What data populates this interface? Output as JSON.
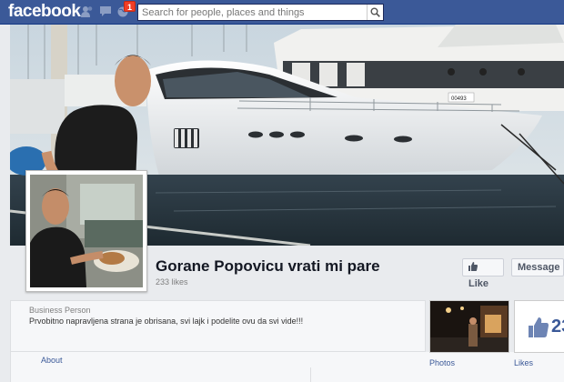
{
  "topbar": {
    "logo": "facebook",
    "notification_count": "1",
    "search_placeholder": "Search for people, places and things"
  },
  "page": {
    "title": "Gorane Popovicu vrati mi pare",
    "likes": "233 likes",
    "like_button": "Like",
    "message_button": "Message",
    "category": "Business Person",
    "description": "Prvobitno napravljena strana je obrisana, svi lajk i podelite ovu da svi vide!!!"
  },
  "tabs": {
    "about": "About",
    "photos": "Photos",
    "likes": "Likes",
    "likes_big_number": "23"
  },
  "boat_label": "00493",
  "colors": {
    "brand_blue": "#3b5998",
    "badge_red": "#f03d25"
  }
}
